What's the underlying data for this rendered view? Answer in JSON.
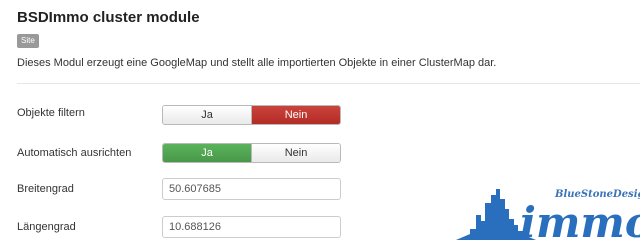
{
  "module": {
    "title": "BSDImmo cluster module",
    "badge": "Site",
    "description": "Dieses Modul erzeugt eine GoogleMap und stellt alle importierten Objekte in einer ClusterMap dar."
  },
  "fields": {
    "filter": {
      "label": "Objekte filtern",
      "option_yes": "Ja",
      "option_no": "Nein",
      "selected": "Nein"
    },
    "align": {
      "label": "Automatisch ausrichten",
      "option_yes": "Ja",
      "option_no": "Nein",
      "selected": "Ja"
    },
    "latitude": {
      "label": "Breitengrad",
      "value": "50.607685"
    },
    "longitude": {
      "label": "Längengrad",
      "value": "10.688126"
    }
  },
  "logo": {
    "caption": "BlueStoneDesign",
    "wordmark": "immo"
  },
  "colors": {
    "no_active": "#bd362f",
    "yes_active": "#51a351",
    "logo_blue": "#2a6fbd"
  }
}
